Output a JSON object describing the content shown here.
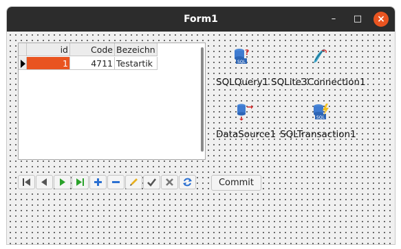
{
  "window": {
    "title": "Form1"
  },
  "titlebar_controls": {
    "minimize": "–",
    "maximize": "□",
    "close": "×"
  },
  "grid": {
    "columns": [
      "id",
      "Code",
      "Bezeichn"
    ],
    "rows": [
      {
        "id": "1",
        "code": "4711",
        "bezeichnung": "Testartik"
      }
    ]
  },
  "navigator": {
    "buttons": [
      {
        "icon": "first-record-icon"
      },
      {
        "icon": "prior-record-icon"
      },
      {
        "icon": "next-record-icon"
      },
      {
        "icon": "last-record-icon"
      },
      {
        "icon": "insert-record-icon"
      },
      {
        "icon": "delete-record-icon"
      },
      {
        "icon": "edit-record-icon"
      },
      {
        "icon": "post-record-icon"
      },
      {
        "icon": "cancel-record-icon"
      },
      {
        "icon": "refresh-icon"
      }
    ]
  },
  "commit_button": {
    "label": "Commit"
  },
  "components": [
    {
      "label": "SQLQuery1",
      "icon": "sqlquery-icon"
    },
    {
      "label": "SQLite3Connection1",
      "icon": "sqlite-connection-icon"
    },
    {
      "label": "DataSource1",
      "icon": "datasource-icon"
    },
    {
      "label": "SQLTransaction1",
      "icon": "sql-transaction-icon"
    }
  ],
  "colors": {
    "selected_cell": "#e95420",
    "titlebar": "#2c2c2c",
    "close_button": "#e95420"
  }
}
